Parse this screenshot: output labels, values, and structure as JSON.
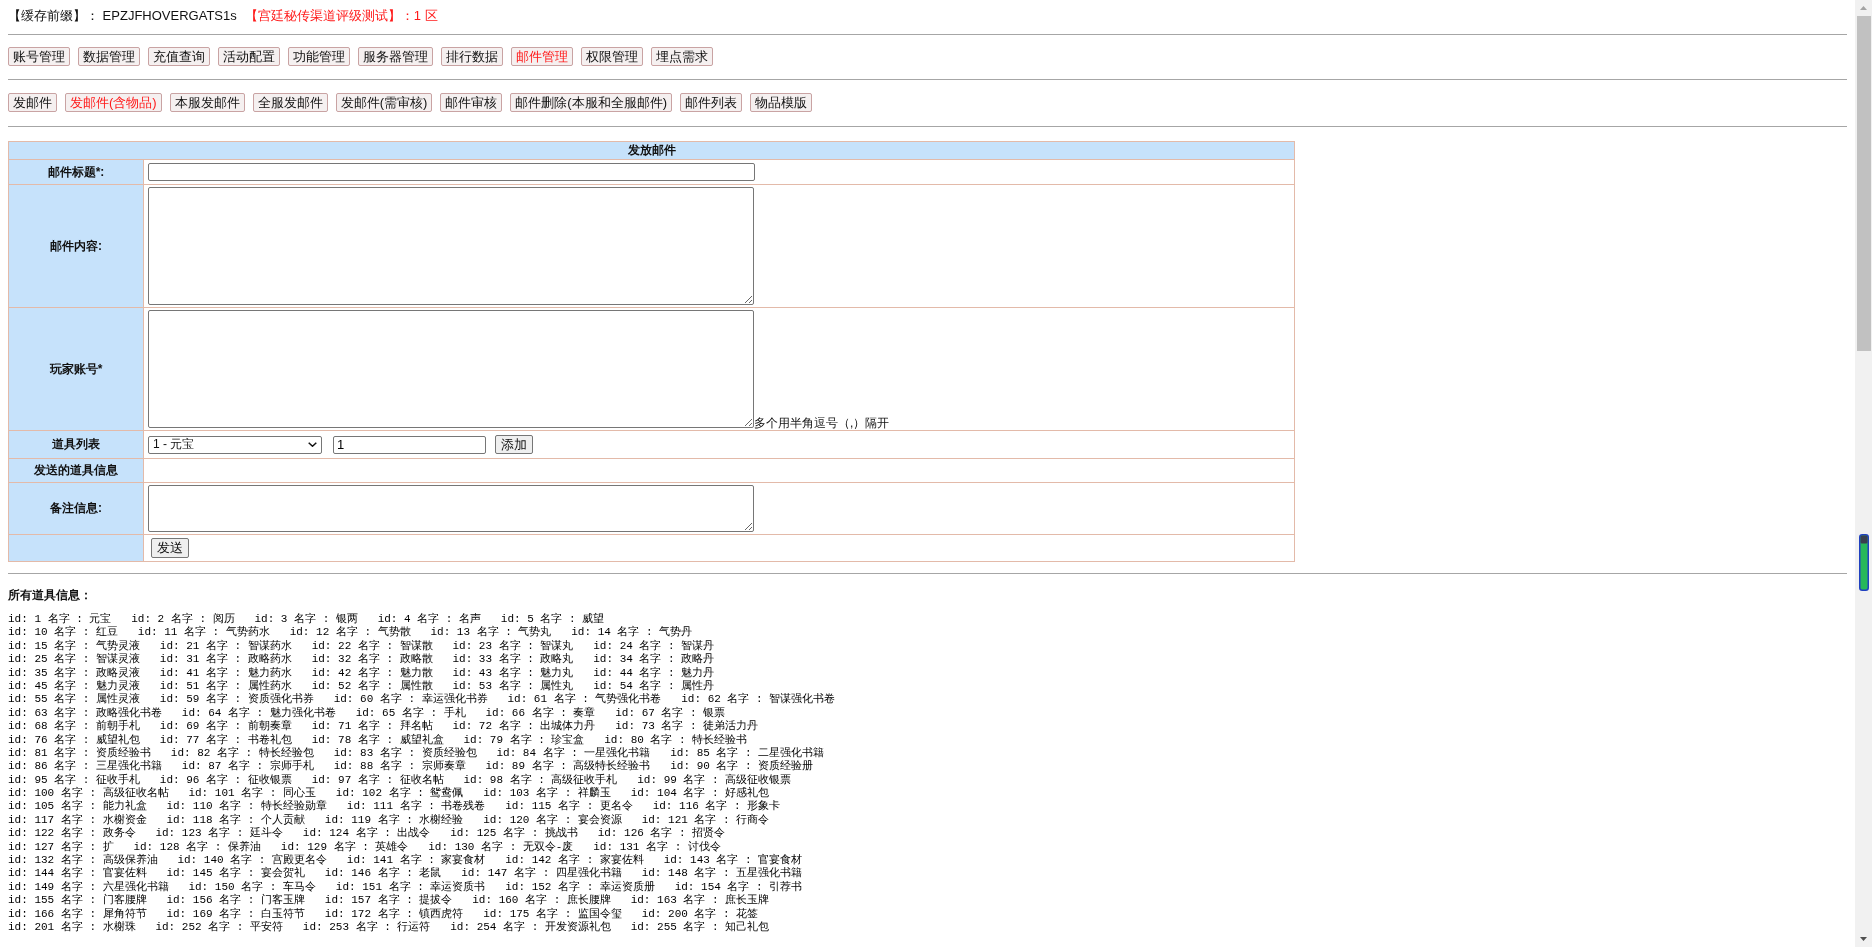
{
  "header": {
    "cache_prefix": "【缓存前缀】： EPZJFHOVERGATS1s",
    "server": "【宫廷秘传渠道评级测试】：1 区"
  },
  "main_menu": [
    {
      "label": "账号管理",
      "selected": false
    },
    {
      "label": "数据管理",
      "selected": false
    },
    {
      "label": "充值查询",
      "selected": false
    },
    {
      "label": "活动配置",
      "selected": false
    },
    {
      "label": "功能管理",
      "selected": false
    },
    {
      "label": "服务器管理",
      "selected": false
    },
    {
      "label": "排行数据",
      "selected": false
    },
    {
      "label": "邮件管理",
      "selected": true
    },
    {
      "label": "权限管理",
      "selected": false
    },
    {
      "label": "埋点需求",
      "selected": false
    }
  ],
  "sub_menu": [
    {
      "label": "发邮件",
      "selected": false
    },
    {
      "label": "发邮件(含物品)",
      "selected": true
    },
    {
      "label": "本服发邮件",
      "selected": false
    },
    {
      "label": "全服发邮件",
      "selected": false
    },
    {
      "label": "发邮件(需审核)",
      "selected": false
    },
    {
      "label": "邮件审核",
      "selected": false
    },
    {
      "label": "邮件删除(本服和全服邮件)",
      "selected": false
    },
    {
      "label": "邮件列表",
      "selected": false
    },
    {
      "label": "物品模版",
      "selected": false
    }
  ],
  "form": {
    "title": "发放邮件",
    "rows": [
      {
        "kind": "text",
        "label": "邮件标题*:"
      },
      {
        "kind": "textarea",
        "label": "邮件内容:"
      },
      {
        "kind": "textarea",
        "label": "玩家账号*",
        "hint": "多个用半角逗号（,）隔开"
      },
      {
        "kind": "picker",
        "label": "道具列表",
        "item": "1 - 元宝",
        "quantity": "1",
        "button": "添加"
      },
      {
        "kind": "info",
        "label": "发送的道具信息"
      },
      {
        "kind": "note",
        "label": "备注信息:"
      },
      {
        "kind": "submit",
        "button": "发送"
      }
    ]
  },
  "items_info": {
    "title": "所有道具信息：",
    "lines": [
      "id: 1 名字 : 元宝   id: 2 名字 : 阅历   id: 3 名字 : 银两   id: 4 名字 : 名声   id: 5 名字 : 威望",
      "id: 10 名字 : 红豆   id: 11 名字 : 气势药水   id: 12 名字 : 气势散   id: 13 名字 : 气势丸   id: 14 名字 : 气势丹",
      "id: 15 名字 : 气势灵液   id: 21 名字 : 智谋药水   id: 22 名字 : 智谋散   id: 23 名字 : 智谋丸   id: 24 名字 : 智谋丹",
      "id: 25 名字 : 智谋灵液   id: 31 名字 : 政略药水   id: 32 名字 : 政略散   id: 33 名字 : 政略丸   id: 34 名字 : 政略丹",
      "id: 35 名字 : 政略灵液   id: 41 名字 : 魅力药水   id: 42 名字 : 魅力散   id: 43 名字 : 魅力丸   id: 44 名字 : 魅力丹",
      "id: 45 名字 : 魅力灵液   id: 51 名字 : 属性药水   id: 52 名字 : 属性散   id: 53 名字 : 属性丸   id: 54 名字 : 属性丹",
      "id: 55 名字 : 属性灵液   id: 59 名字 : 资质强化书券   id: 60 名字 : 幸运强化书券   id: 61 名字 : 气势强化书卷   id: 62 名字 : 智谋强化书卷",
      "id: 63 名字 : 政略强化书卷   id: 64 名字 : 魅力强化书卷   id: 65 名字 : 手札   id: 66 名字 : 奏章   id: 67 名字 : 银票",
      "id: 68 名字 : 前朝手札   id: 69 名字 : 前朝奏章   id: 71 名字 : 拜名帖   id: 72 名字 : 出城体力丹   id: 73 名字 : 徒弟活力丹",
      "id: 76 名字 : 威望礼包   id: 77 名字 : 书卷礼包   id: 78 名字 : 威望礼盒   id: 79 名字 : 珍宝盒   id: 80 名字 : 特长经验书",
      "id: 81 名字 : 资质经验书   id: 82 名字 : 特长经验包   id: 83 名字 : 资质经验包   id: 84 名字 : 一星强化书籍   id: 85 名字 : 二星强化书籍",
      "id: 86 名字 : 三星强化书籍   id: 87 名字 : 宗师手札   id: 88 名字 : 宗师奏章   id: 89 名字 : 高级特长经验书   id: 90 名字 : 资质经验册",
      "id: 95 名字 : 征收手札   id: 96 名字 : 征收银票   id: 97 名字 : 征收名帖   id: 98 名字 : 高级征收手札   id: 99 名字 : 高级征收银票",
      "id: 100 名字 : 高级征收名帖   id: 101 名字 : 同心玉   id: 102 名字 : 鸳鸯佩   id: 103 名字 : 祥麟玉   id: 104 名字 : 好感礼包",
      "id: 105 名字 : 能力礼盒   id: 110 名字 : 特长经验勋章   id: 111 名字 : 书卷残卷   id: 115 名字 : 更名令   id: 116 名字 : 形象卡",
      "id: 117 名字 : 水榭资金   id: 118 名字 : 个人贡献   id: 119 名字 : 水榭经验   id: 120 名字 : 宴会资源   id: 121 名字 : 行商令",
      "id: 122 名字 : 政务令   id: 123 名字 : 廷斗令   id: 124 名字 : 出战令   id: 125 名字 : 挑战书   id: 126 名字 : 招贤令",
      "id: 127 名字 : 扩   id: 128 名字 : 保养油   id: 129 名字 : 英雄令   id: 130 名字 : 无双令-废   id: 131 名字 : 讨伐令",
      "id: 132 名字 : 高级保养油   id: 140 名字 : 宫殿更名令   id: 141 名字 : 家宴食材   id: 142 名字 : 家宴佐料   id: 143 名字 : 官宴食材",
      "id: 144 名字 : 官宴佐料   id: 145 名字 : 宴会贺礼   id: 146 名字 : 老鼠   id: 147 名字 : 四星强化书籍   id: 148 名字 : 五星强化书籍",
      "id: 149 名字 : 六星强化书籍   id: 150 名字 : 车马令   id: 151 名字 : 幸运资质书   id: 152 名字 : 幸运资质册   id: 154 名字 : 引荐书",
      "id: 155 名字 : 门客腰牌   id: 156 名字 : 门客玉牌   id: 157 名字 : 提拔令   id: 160 名字 : 庶长腰牌   id: 163 名字 : 庶长玉牌",
      "id: 166 名字 : 犀角符节   id: 169 名字 : 白玉符节   id: 172 名字 : 镇西虎符   id: 175 名字 : 监国令玺   id: 200 名字 : 花签",
      "id: 201 名字 : 水榭珠   id: 252 名字 : 平安符   id: 253 名字 : 行运符   id: 254 名字 : 开发资源礼包   id: 255 名字 : 知己礼包"
    ]
  }
}
